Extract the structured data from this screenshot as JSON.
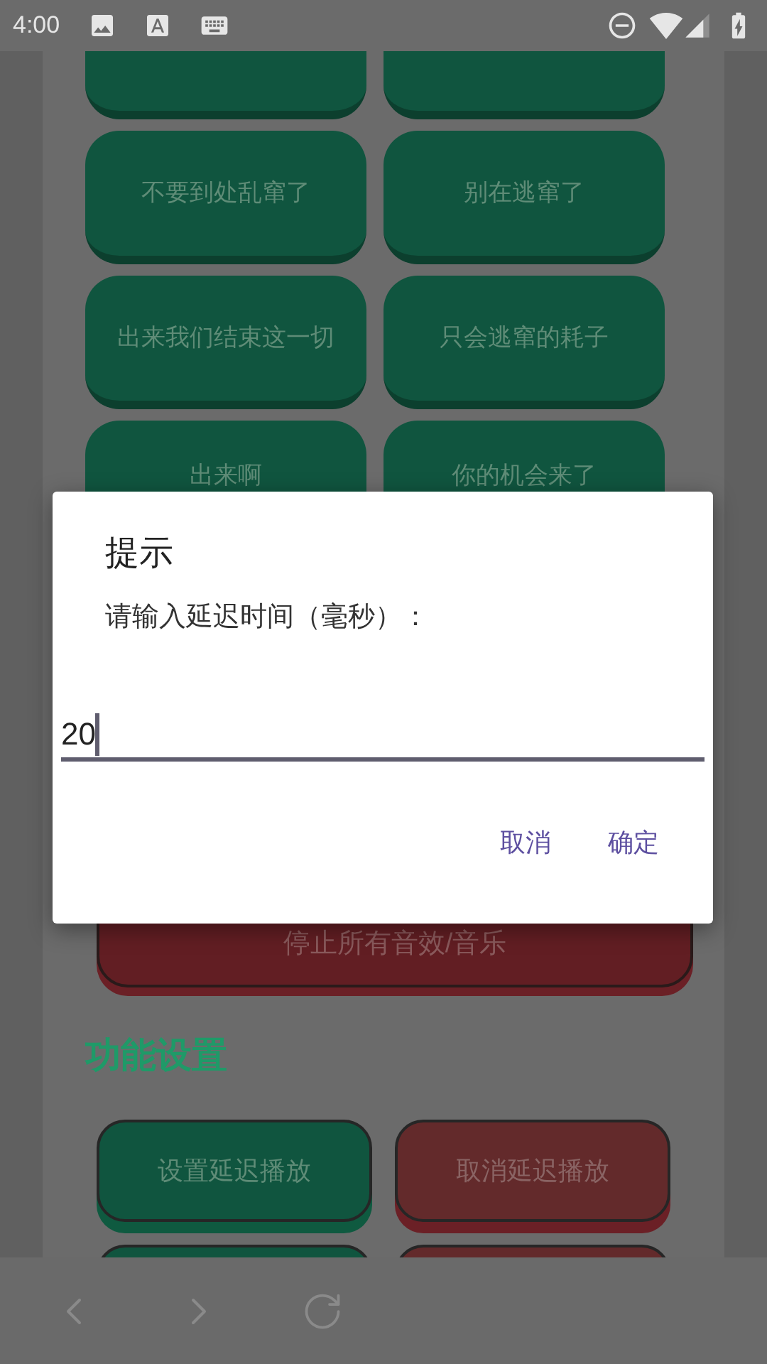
{
  "status_bar": {
    "time": "4:00"
  },
  "sound_buttons": [
    {
      "label": "不要到处乱窜了"
    },
    {
      "label": "别在逃窜了"
    },
    {
      "label": "出来我们结束这一切"
    },
    {
      "label": "只会逃窜的耗子"
    },
    {
      "label": "出来啊"
    },
    {
      "label": "你的机会来了"
    }
  ],
  "stop_button": {
    "label": "停止所有音效/音乐"
  },
  "feature_settings": {
    "title": "功能设置",
    "buttons": [
      {
        "label": "设置延迟播放",
        "kind": "confirm"
      },
      {
        "label": "取消延迟播放",
        "kind": "cancel"
      }
    ]
  },
  "dialog": {
    "title": "提示",
    "message": "请输入延迟时间（毫秒）：",
    "input": {
      "value": "20"
    },
    "buttons": [
      {
        "label": "取消"
      },
      {
        "label": "确定"
      }
    ]
  }
}
